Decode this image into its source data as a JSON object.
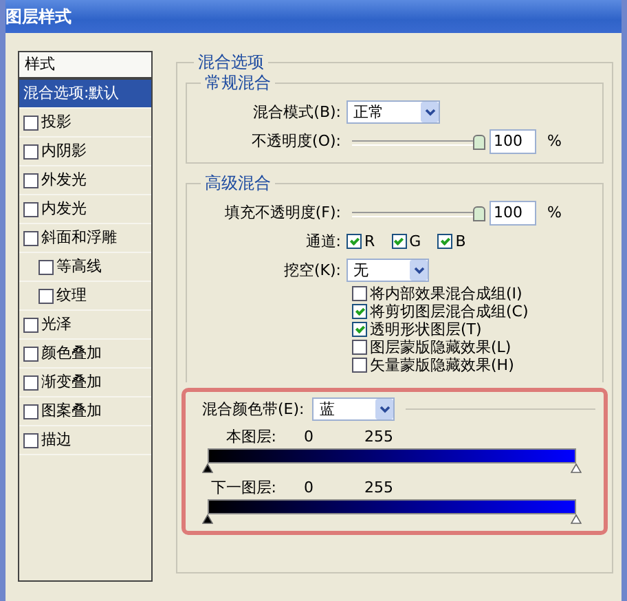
{
  "window": {
    "title": "图层样式"
  },
  "sidebar": {
    "header": "样式",
    "items": [
      {
        "kind": "plain",
        "label": "混合选项:默认",
        "selected": true
      },
      {
        "kind": "check",
        "label": "投影",
        "checked": false,
        "selected": false
      },
      {
        "kind": "check",
        "label": "内阴影",
        "checked": false,
        "selected": false
      },
      {
        "kind": "check",
        "label": "外发光",
        "checked": false,
        "selected": false
      },
      {
        "kind": "check",
        "label": "内发光",
        "checked": false,
        "selected": false
      },
      {
        "kind": "check",
        "label": "斜面和浮雕",
        "checked": false,
        "selected": false,
        "children": [
          {
            "kind": "check",
            "label": "等高线",
            "checked": false,
            "selected": false
          },
          {
            "kind": "check",
            "label": "纹理",
            "checked": false,
            "selected": false
          }
        ]
      },
      {
        "kind": "check",
        "label": "光泽",
        "checked": false,
        "selected": false
      },
      {
        "kind": "check",
        "label": "颜色叠加",
        "checked": false,
        "selected": false
      },
      {
        "kind": "check",
        "label": "渐变叠加",
        "checked": false,
        "selected": false
      },
      {
        "kind": "check",
        "label": "图案叠加",
        "checked": false,
        "selected": false
      },
      {
        "kind": "check",
        "label": "描边",
        "checked": false,
        "selected": false
      }
    ]
  },
  "blending_options": {
    "title": "混合选项",
    "general": {
      "title": "常规混合",
      "mode_label": "混合模式(B):",
      "mode_value": "正常",
      "opacity_label": "不透明度(O):",
      "opacity": {
        "level": 1,
        "value": "100",
        "unit": "%"
      }
    },
    "advanced": {
      "title": "高级混合",
      "fill_label": "填充不透明度(F):",
      "fill": {
        "level": 1,
        "value": "100",
        "unit": "%"
      },
      "channels_label": "通道:",
      "channels": [
        {
          "label": "R",
          "checked": true
        },
        {
          "label": "G",
          "checked": true
        },
        {
          "label": "B",
          "checked": true
        }
      ],
      "knockout_label": "挖空(K):",
      "knockout_value": "无",
      "options": [
        {
          "label": "将内部效果混合成组(I)",
          "checked": false
        },
        {
          "label": "将剪切图层混合成组(C)",
          "checked": true
        },
        {
          "label": "透明形状图层(T)",
          "checked": true
        },
        {
          "label": "图层蒙版隐藏效果(L)",
          "checked": false
        },
        {
          "label": "矢量蒙版隐藏效果(H)",
          "checked": false
        }
      ]
    },
    "blend_if": {
      "label": "混合颜色带(E):",
      "value": "蓝",
      "bands": [
        {
          "label": "本图层:",
          "low": "0",
          "high": "255",
          "thumbs": [
            {
              "level": 0
            },
            {
              "level": 1
            }
          ]
        },
        {
          "label": "下一图层:",
          "low": "0",
          "high": "255",
          "thumbs": [
            {
              "level": 0
            },
            {
              "level": 1
            }
          ]
        }
      ]
    }
  }
}
